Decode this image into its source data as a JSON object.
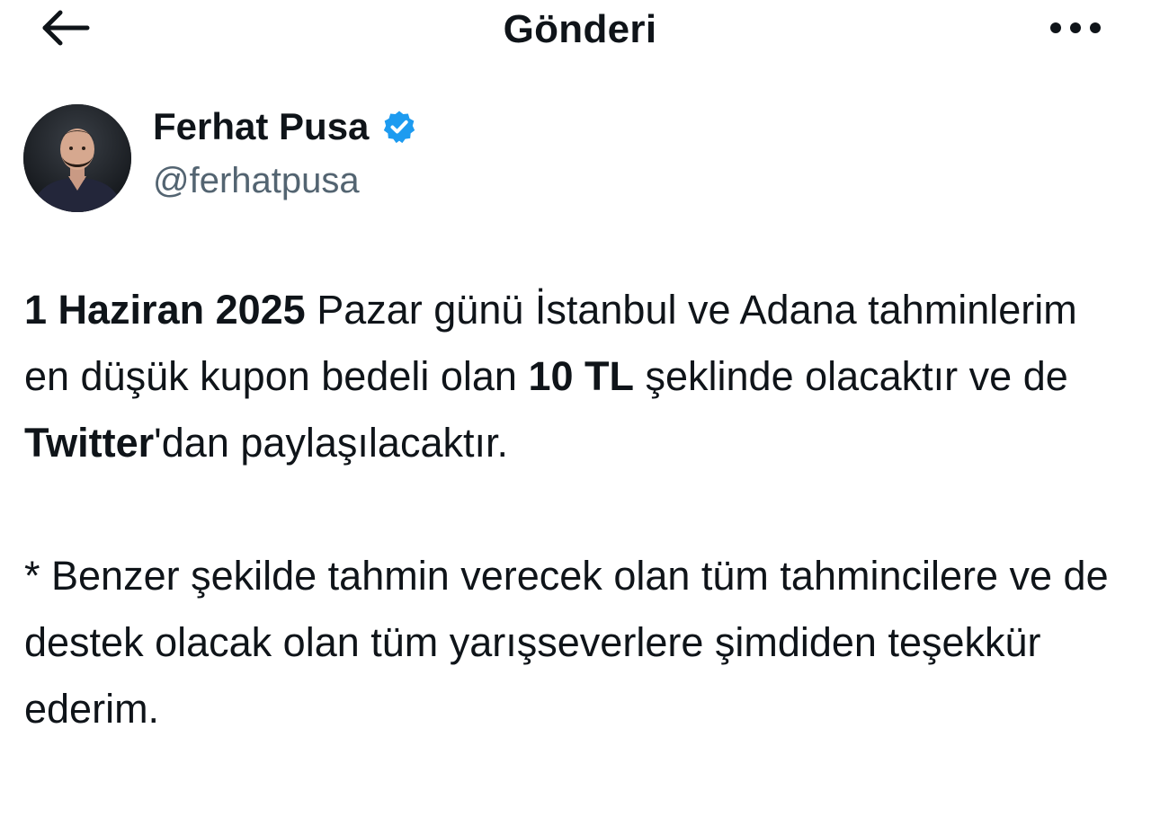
{
  "header": {
    "title": "Gönderi",
    "back_icon": "arrow-left-icon",
    "more_icon": "more-horizontal-icon"
  },
  "author": {
    "name": "Ferhat Pusa",
    "handle": "@ferhatpusa",
    "verified": true,
    "verified_color": "#1d9bf0"
  },
  "tweet": {
    "p1": {
      "date": "1 Haziran 2025",
      "t1": " Pazar günü İstanbul ve Adana tahminlerim en düşük kupon bedeli olan ",
      "amount": "10 TL",
      "t2": " şeklinde olacaktır ve de ",
      "platform": "Twitter",
      "t3": "'dan paylaşılacaktır."
    },
    "p2": "* Benzer şekilde tahmin verecek olan tüm tahmincilere ve de destek olacak olan tüm yarışseverlere şimdiden teşekkür ederim."
  },
  "colors": {
    "text": "#0f1419",
    "secondary": "#536471",
    "background": "#ffffff"
  }
}
